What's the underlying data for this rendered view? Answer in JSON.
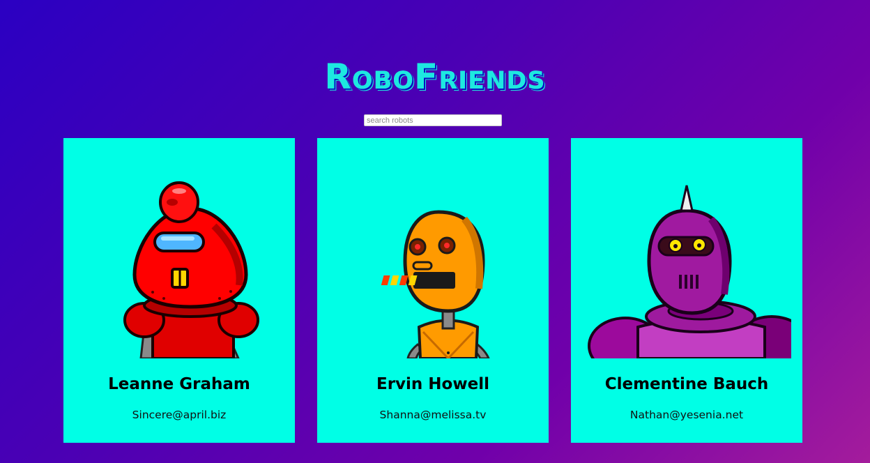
{
  "header": {
    "title": "RoboFriends"
  },
  "search": {
    "placeholder": "search robots",
    "value": ""
  },
  "colors": {
    "card_background": "#00ffe6",
    "title_color": "#1de9e0",
    "background_start": "#2b00c2",
    "background_end": "#a41c9c"
  },
  "robots": [
    {
      "name": "Leanne Graham",
      "email": "Sincere@april.biz",
      "avatar": "red-robot-icon"
    },
    {
      "name": "Ervin Howell",
      "email": "Shanna@melissa.tv",
      "avatar": "orange-robot-icon"
    },
    {
      "name": "Clementine Bauch",
      "email": "Nathan@yesenia.net",
      "avatar": "purple-robot-icon"
    }
  ]
}
